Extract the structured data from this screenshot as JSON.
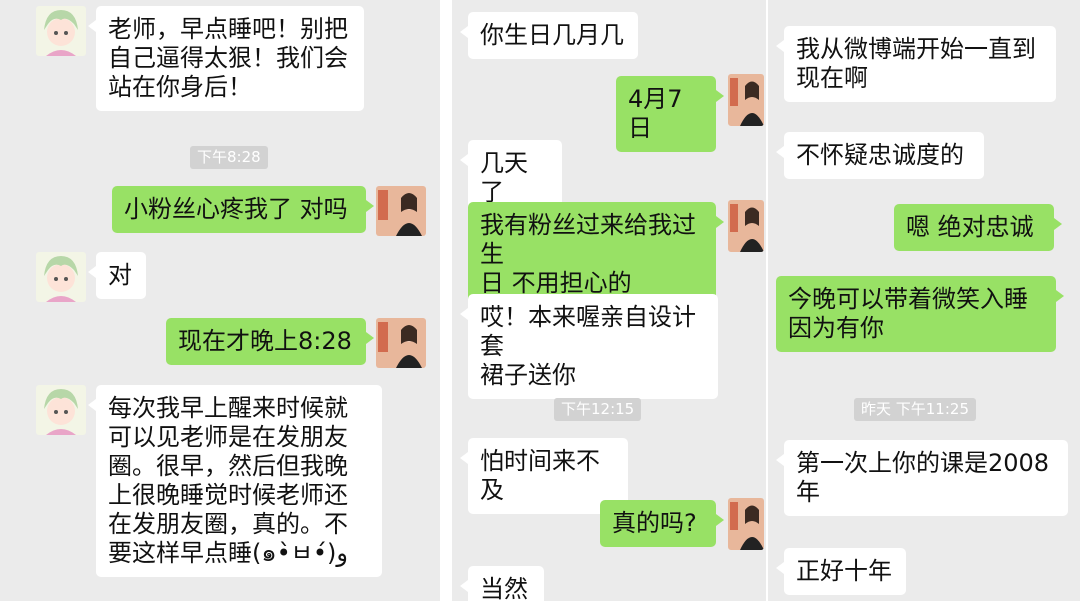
{
  "panel1": {
    "msg1": "老师，早点睡吧！别把\n自己逼得太狠！我们会\n站在你身后！",
    "time1": "下午8:28",
    "msg2": "小粉丝心疼我了 对吗",
    "msg3": "对",
    "msg4": "现在才晚上8:28",
    "msg5": "每次我早上醒来时候就\n可以见老师是在发朋友\n圈。很早，然后但我晚\n上很晚睡觉时候老师还\n在发朋友圈，真的。不\n要这样早点睡(๑•̀ㅂ•́)و"
  },
  "panel2": {
    "msg1": "你生日几月几",
    "msg2": "4月7日",
    "msg3": "几天了",
    "msg4": "我有粉丝过来给我过生\n日 不用担心的",
    "msg5": "哎！本来喔亲自设计套\n裙子送你",
    "time1": "下午12:15",
    "msg6": "怕时间来不及",
    "msg7": "真的吗?",
    "msg8": "当然"
  },
  "panel3": {
    "msg1": "我从微博端开始一直到\n现在啊",
    "msg2": "不怀疑忠诚度的",
    "msg3": "嗯 绝对忠诚",
    "msg4": "今晚可以带着微笑入睡\n因为有你",
    "time1": "昨天 下午11:25",
    "msg5": "第一次上你的课是2008\n年",
    "msg6": "正好十年"
  },
  "colors": {
    "sent": "#98e165",
    "received": "#ffffff",
    "background": "#ebebeb"
  },
  "icons": {
    "fan_avatar": "anime-girl-avatar-icon",
    "teacher_avatar": "teacher-avatar-icon"
  }
}
